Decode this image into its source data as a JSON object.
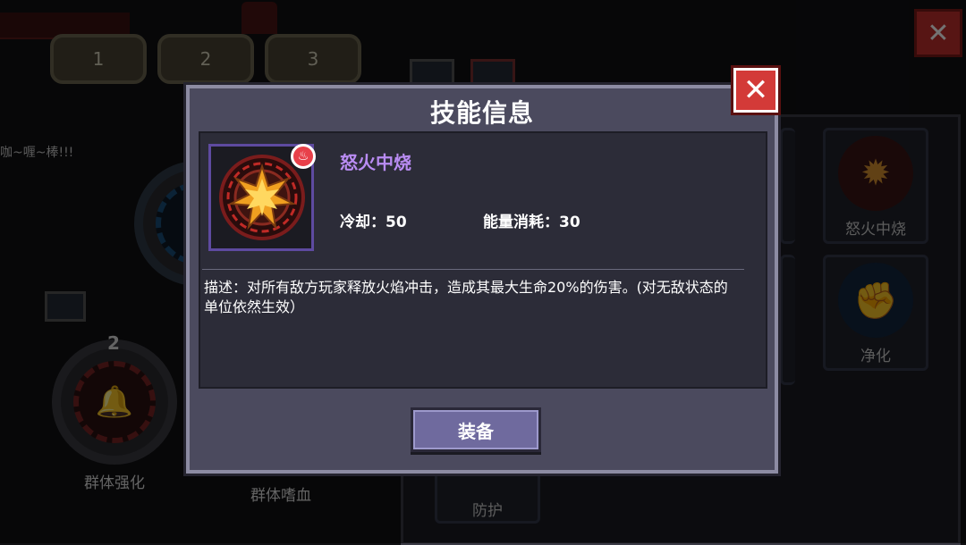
{
  "background": {
    "slot_tabs": [
      "1",
      "2",
      "3"
    ],
    "close_symbol": "✕",
    "cheer_text": "咖~喱~棒!!!",
    "skills": [
      {
        "label": "群体强化",
        "level": "2"
      },
      {
        "label": "群体嗜血"
      }
    ],
    "grid": [
      {
        "label": "怒火中烧"
      },
      {
        "label": "净化"
      },
      {
        "label": "防护"
      }
    ]
  },
  "dialog": {
    "title": "技能信息",
    "close_symbol": "✕",
    "skill": {
      "name": "怒火中烧",
      "icon": "fire-burst-icon",
      "badge_icon": "flame-badge-icon",
      "cooldown_text": "冷却：50",
      "energy_text": "能量消耗：30"
    },
    "description": "描述：对所有敌方玩家释放火焰冲击，造成其最大生命20%的伤害。(对无敌状态的单位依然生效）",
    "equip_label": "装备"
  },
  "colors": {
    "dialog_bg": "#4b4a5e",
    "dialog_border": "#8d8ca3",
    "content_bg": "#2c2c38",
    "skill_name": "#b98cf2",
    "close_red": "#d33a38",
    "button_bg": "#6f6a9e"
  }
}
